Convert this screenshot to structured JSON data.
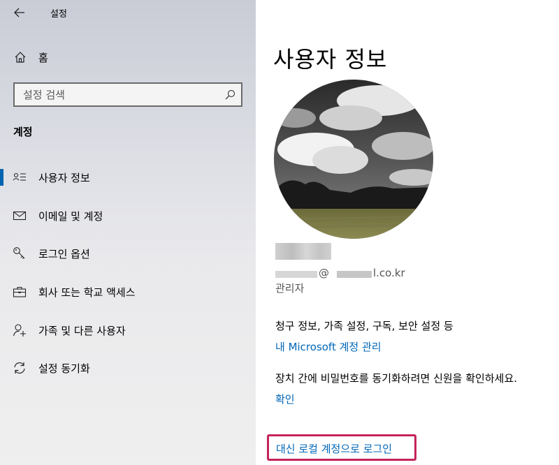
{
  "window": {
    "title": "설정"
  },
  "sidebar": {
    "home_label": "홈",
    "search_placeholder": "설정 검색",
    "section_heading": "계정",
    "items": [
      {
        "label": "사용자 정보",
        "icon": "user-info-icon",
        "active": true
      },
      {
        "label": "이메일 및 계정",
        "icon": "mail-icon",
        "active": false
      },
      {
        "label": "로그인 옵션",
        "icon": "key-icon",
        "active": false
      },
      {
        "label": "회사 또는 학교 액세스",
        "icon": "briefcase-icon",
        "active": false
      },
      {
        "label": "가족 및 다른 사용자",
        "icon": "add-user-icon",
        "active": false
      },
      {
        "label": "설정 동기화",
        "icon": "sync-icon",
        "active": false
      }
    ]
  },
  "main": {
    "title": "사용자 정보",
    "email_at": "@",
    "email_domain": "l.co.kr",
    "role": "관리자",
    "billing_text": "청구 정보, 가족 설정, 구독, 보안 설정 등",
    "manage_link": "내 Microsoft 계정 관리",
    "sync_text": "장치 간에 비밀번호를 동기화하려면 신원을 확인하세요.",
    "verify_link": "확인",
    "local_signin": "대신 로컬 계정으로 로그인"
  },
  "colors": {
    "accent": "#0063b1",
    "link": "#0067b8",
    "highlight_border": "#c4245b"
  }
}
